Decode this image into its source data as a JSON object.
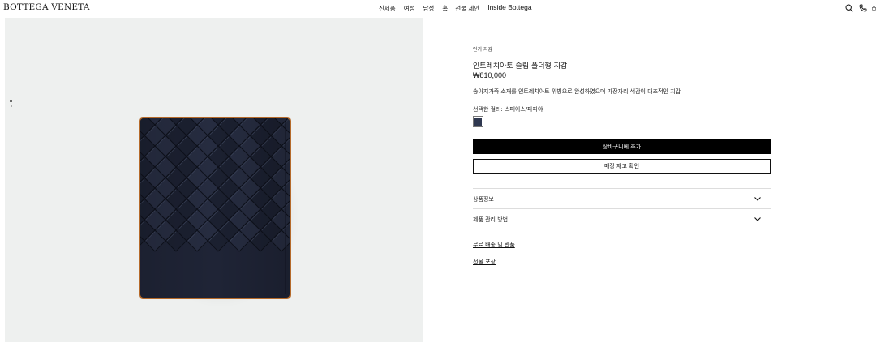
{
  "header": {
    "logo": "BOTTEGA VENETA",
    "nav": [
      "신제품",
      "여성",
      "남성",
      "홈",
      "선물 제안",
      "Inside Bottega"
    ],
    "icons": [
      "search-icon",
      "phone-icon",
      "bag-icon"
    ]
  },
  "gallery": {
    "image_count_indicator": 2,
    "active_index": 0,
    "background_color": "#eef0ef",
    "product_color": "#1f2436",
    "edge_color": "#b56a2a"
  },
  "product": {
    "category": "인기 지갑",
    "name": "인트레치아토 슬림 폴더형 지갑",
    "price": "₩810,000",
    "description": "송아지가죽 소재를 인트레치아토 위빙으로 완성하였으며 가장자리 색감이 대조적인 지갑",
    "color_label": "선택한 컬러: 스페이스/파파야",
    "swatch_color": "#2f3850"
  },
  "actions": {
    "add_to_cart": "장바구니에 추가",
    "check_stock": "매장 재고 확인"
  },
  "accordions": [
    {
      "label": "상품정보"
    },
    {
      "label": "제품 관리 방법"
    }
  ],
  "links": {
    "shipping": "무료 배송 및 반품",
    "gift_wrap": "선물 포장"
  }
}
